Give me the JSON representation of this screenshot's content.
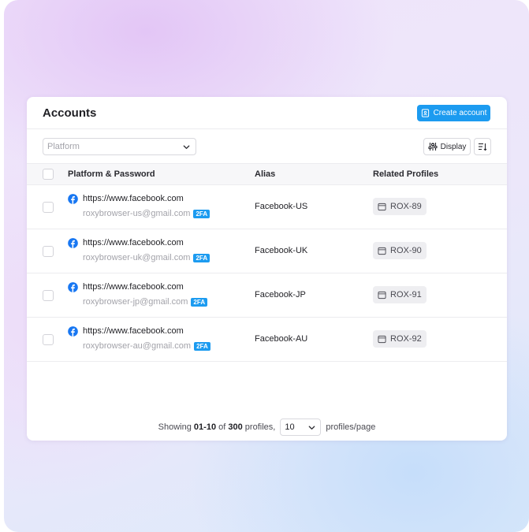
{
  "header": {
    "title": "Accounts",
    "create_label": "Create account"
  },
  "toolbar": {
    "platform_placeholder": "Platform",
    "display_label": "Display"
  },
  "table": {
    "columns": [
      "Platform & Password",
      "Alias",
      "Related Profiles"
    ],
    "rows": [
      {
        "url": "https://www.facebook.com",
        "email": "roxybrowser-us@gmail.com",
        "badge": "2FA",
        "alias": "Facebook-US",
        "profile": "ROX-89"
      },
      {
        "url": "https://www.facebook.com",
        "email": "roxybrowser-uk@gmail.com",
        "badge": "2FA",
        "alias": "Facebook-UK",
        "profile": "ROX-90"
      },
      {
        "url": "https://www.facebook.com",
        "email": "roxybrowser-jp@gmail.com",
        "badge": "2FA",
        "alias": "Facebook-JP",
        "profile": "ROX-91"
      },
      {
        "url": "https://www.facebook.com",
        "email": "roxybrowser-au@gmail.com",
        "badge": "2FA",
        "alias": "Facebook-AU",
        "profile": "ROX-92"
      }
    ]
  },
  "footer": {
    "showing_prefix": "Showing",
    "range": "01-10",
    "of_text": "of",
    "total": "300",
    "profiles_text": "profiles,",
    "page_size": "10",
    "per_page_text": "profiles/page"
  },
  "colors": {
    "accent": "#1c9bf0",
    "facebook": "#1877f2"
  }
}
